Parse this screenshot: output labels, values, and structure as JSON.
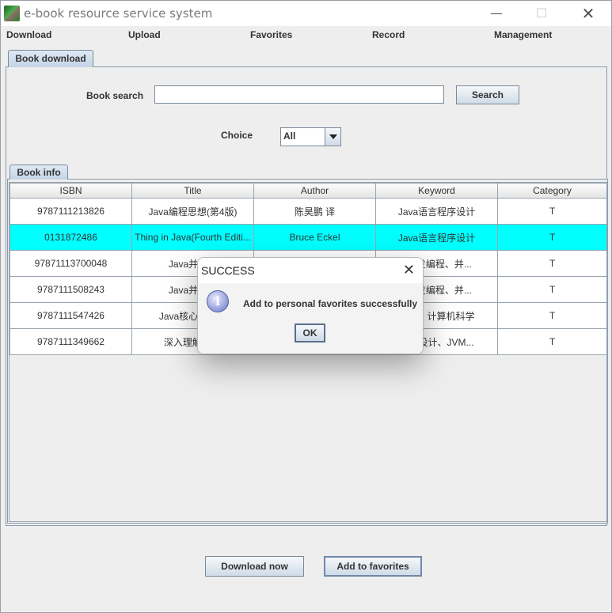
{
  "window": {
    "title": "e-book resource service system"
  },
  "menu": [
    "Download",
    "Upload",
    "Favorites",
    "Record",
    "Management"
  ],
  "tabs": {
    "main": "Book download",
    "inner": "Book info"
  },
  "search": {
    "label": "Book search",
    "value": "",
    "button": "Search"
  },
  "choice": {
    "label": "Choice",
    "selected": "All"
  },
  "table": {
    "headers": [
      "ISBN",
      "Title",
      "Author",
      "Keyword",
      "Category"
    ],
    "rows": [
      [
        "9787111213826",
        "Java编程思想(第4版)",
        "陈昊鹏 译",
        "Java语言程序设计",
        "T"
      ],
      [
        "0131872486",
        "Thing in Java(Fourth Editi...",
        "Bruce Eckel",
        "Java语言程序设计",
        "T"
      ],
      [
        "97871113700048",
        "Java并发编",
        "",
        "a并发编程、并...",
        "T"
      ],
      [
        "9787111508243",
        "Java并发编",
        "",
        "a并发编程、并...",
        "T"
      ],
      [
        "9787111547426",
        "Java核心技术卷",
        "",
        "设计、计算机科学",
        "T"
      ],
      [
        "9787111349662",
        "深入理解Java",
        "",
        "程序设计、JVM...",
        "T"
      ]
    ],
    "selected_row": 1
  },
  "buttons": {
    "download": "Download now",
    "favorite": "Add to favorites"
  },
  "dialog": {
    "title": "SUCCESS",
    "message": "Add to personal favorites successfully",
    "ok": "OK",
    "icon": "info-icon"
  },
  "colors": {
    "selection": "#00ffff",
    "tab": "#c3d4e6"
  }
}
